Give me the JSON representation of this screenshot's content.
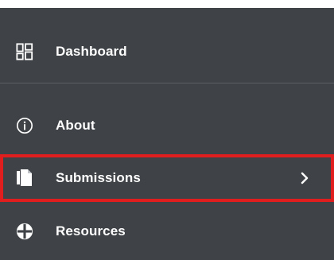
{
  "nav": {
    "items": [
      {
        "label": "Dashboard",
        "icon": "dashboard-icon"
      },
      {
        "label": "About",
        "icon": "info-icon"
      },
      {
        "label": "Submissions",
        "icon": "documents-icon",
        "has_submenu": true,
        "highlighted": true
      },
      {
        "label": "Resources",
        "icon": "globe-icon"
      }
    ],
    "highlight_color": "#e01e1e",
    "background_color": "#3f4347"
  }
}
